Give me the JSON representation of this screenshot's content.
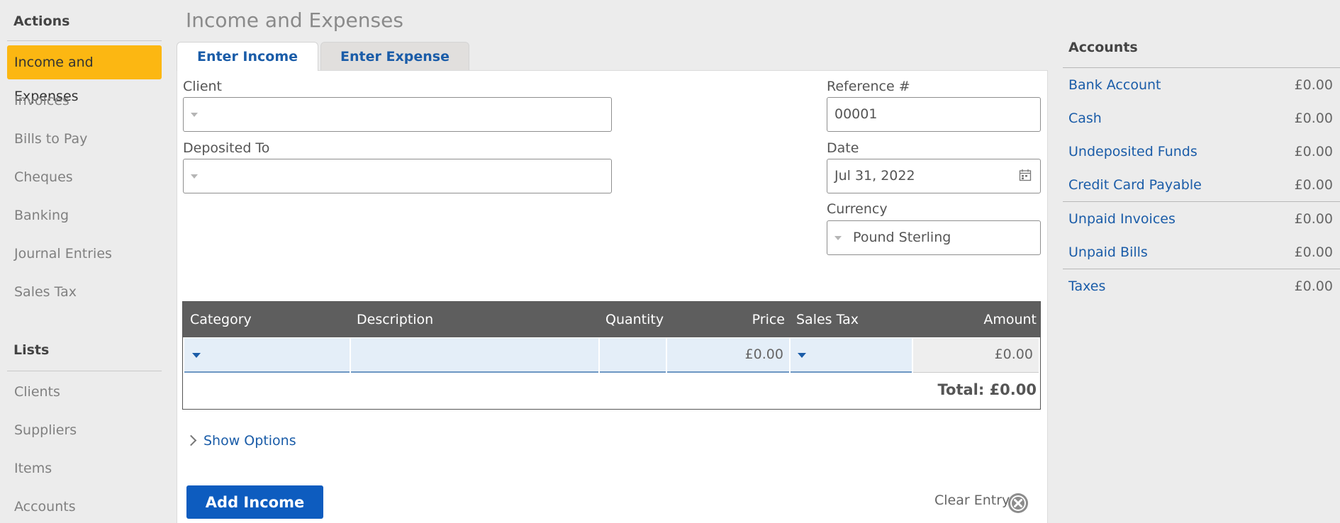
{
  "sidebar": {
    "actions_heading": "Actions",
    "actions": [
      "Income and Expenses",
      "Invoices",
      "Bills to Pay",
      "Cheques",
      "Banking",
      "Journal Entries",
      "Sales Tax"
    ],
    "lists_heading": "Lists",
    "lists": [
      "Clients",
      "Suppliers",
      "Items",
      "Accounts"
    ]
  },
  "page": {
    "title": "Income and Expenses"
  },
  "tabs": {
    "income": "Enter Income",
    "expense": "Enter Expense"
  },
  "form": {
    "client_label": "Client",
    "client_value": "",
    "deposited_label": "Deposited To",
    "deposited_value": "",
    "reference_label": "Reference #",
    "reference_value": "00001",
    "date_label": "Date",
    "date_value": "Jul 31, 2022",
    "currency_label": "Currency",
    "currency_value": "Pound Sterling"
  },
  "table": {
    "headers": {
      "category": "Category",
      "description": "Description",
      "quantity": "Quantity",
      "price": "Price",
      "sales_tax": "Sales Tax",
      "amount": "Amount"
    },
    "row": {
      "price": "£0.00",
      "amount": "£0.00"
    },
    "total": "Total: £0.00"
  },
  "show_options": "Show Options",
  "buttons": {
    "add": "Add Income",
    "clear": "Clear Entry"
  },
  "accounts": {
    "heading": "Accounts",
    "items": [
      {
        "name": "Bank Account",
        "value": "£0.00"
      },
      {
        "name": "Cash",
        "value": "£0.00"
      },
      {
        "name": "Undeposited Funds",
        "value": "£0.00"
      },
      {
        "name": "Credit Card Payable",
        "value": "£0.00"
      },
      {
        "name": "Unpaid Invoices",
        "value": "£0.00"
      },
      {
        "name": "Unpaid Bills",
        "value": "£0.00"
      },
      {
        "name": "Taxes",
        "value": "£0.00"
      }
    ]
  },
  "colors": {
    "accent": "#fcb712",
    "link": "#1a5ca8",
    "primary_button": "#0d5cbf",
    "table_header": "#5e5e5e"
  }
}
